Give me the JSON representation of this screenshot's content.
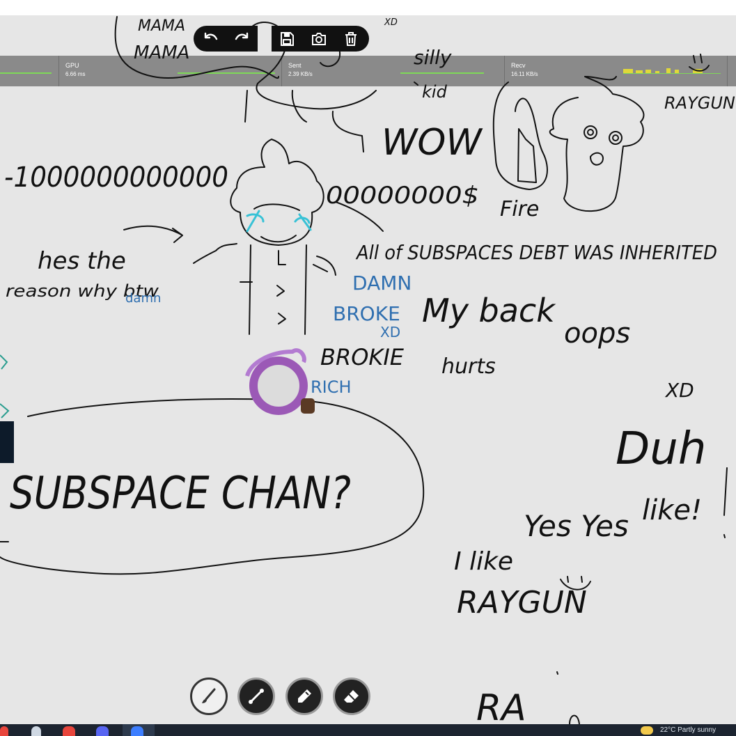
{
  "perf": [
    {
      "name": "",
      "value": ""
    },
    {
      "name": "GPU",
      "value": "6.66 ms"
    },
    {
      "name": "Sent",
      "value": "2.39 KB/s"
    },
    {
      "name": "",
      "value": ""
    },
    {
      "name": "Recv",
      "value": "16.11 KB/s"
    }
  ],
  "toolbar": {
    "undo": "undo-icon",
    "redo": "redo-icon",
    "save": "save-icon",
    "screenshot": "camera-icon",
    "clear": "trash-icon"
  },
  "tools": [
    "brush",
    "line",
    "marker",
    "eraser"
  ],
  "drawing_text": {
    "mama": "MAMA",
    "mama_top": "MAMA",
    "xd_top": "XD",
    "silly": "silly",
    "kid": "kid",
    "raygun": "RAYGUN",
    "wow": "WOW",
    "minus": "-1000000000000",
    "zeros": "00000000$",
    "fire": "Fire",
    "hes_the": "hes the",
    "reason_why": "reason why btw",
    "damn_small": "damn",
    "all_of": "All of SUBSPACES DEBT WAS INHERITED",
    "damn": "DAMN",
    "broke": "BROKE",
    "xd_blue": "XD",
    "brokie": "BROKIE",
    "rich": "RICH",
    "my_back": "My back",
    "hurts": "hurts",
    "oops": "oops",
    "xd": "XD",
    "duh": "Duh",
    "like_excl": "like!",
    "yes_yes": "Yes Yes",
    "i_like": "I like",
    "raygun_big": "RAYGUN",
    "smile": ":)",
    "subspace_chan": "SUBSPACE CHAN?",
    "ra": "RA"
  },
  "taskbar": {
    "tray_text": "22°C  Partly sunny"
  },
  "colors": {
    "ink": "#111111",
    "blue_ink": "#2f6fb0",
    "cyan": "#38c2d6",
    "purple": "#9b59b6",
    "perf_bar": "#8a8a8a",
    "graph_green": "#7ed957",
    "graph_yellow": "#e0d83a"
  }
}
